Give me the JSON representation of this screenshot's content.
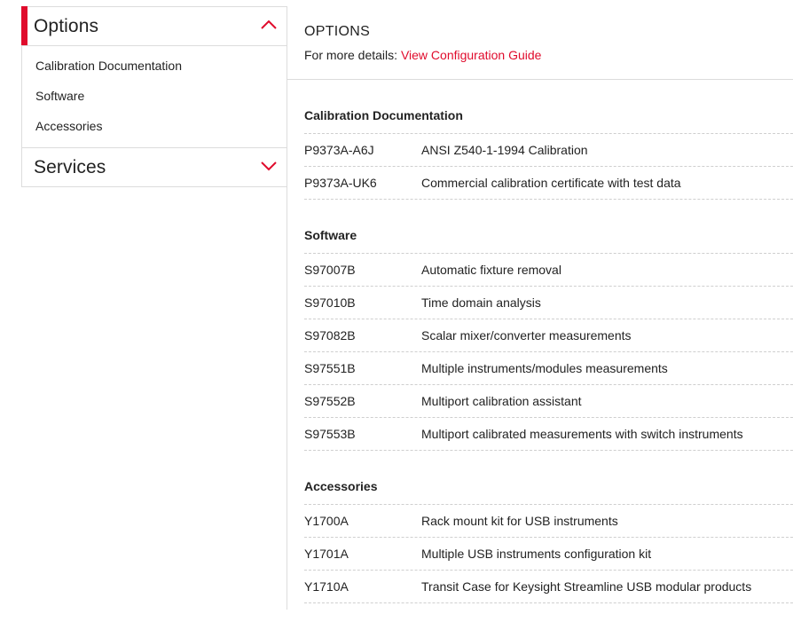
{
  "sidebar": {
    "options": {
      "title": "Options",
      "items": [
        {
          "label": "Calibration Documentation"
        },
        {
          "label": "Software"
        },
        {
          "label": "Accessories"
        }
      ]
    },
    "services": {
      "title": "Services"
    }
  },
  "main": {
    "title": "OPTIONS",
    "details_prefix": "For more details:",
    "details_link": "View Configuration Guide",
    "sections": [
      {
        "title": "Calibration Documentation",
        "rows": [
          {
            "code": "P9373A-A6J",
            "desc": "ANSI Z540-1-1994 Calibration"
          },
          {
            "code": "P9373A-UK6",
            "desc": "Commercial calibration certificate with test data"
          }
        ]
      },
      {
        "title": "Software",
        "rows": [
          {
            "code": "S97007B",
            "desc": "Automatic fixture removal"
          },
          {
            "code": "S97010B",
            "desc": "Time domain analysis"
          },
          {
            "code": "S97082B",
            "desc": "Scalar mixer/converter measurements"
          },
          {
            "code": "S97551B",
            "desc": "Multiple instruments/modules measurements"
          },
          {
            "code": "S97552B",
            "desc": "Multiport calibration assistant"
          },
          {
            "code": "S97553B",
            "desc": "Multiport calibrated measurements with switch instruments"
          }
        ]
      },
      {
        "title": "Accessories",
        "rows": [
          {
            "code": "Y1700A",
            "desc": "Rack mount kit for USB instruments"
          },
          {
            "code": "Y1701A",
            "desc": "Multiple USB instruments configuration kit"
          },
          {
            "code": "Y1710A",
            "desc": "Transit Case for Keysight Streamline USB modular products"
          }
        ]
      }
    ]
  },
  "colors": {
    "accent": "#e00b2c",
    "border": "#dcdcdc",
    "text": "#222222"
  },
  "icons": {
    "options_toggle": "chevron-up-icon",
    "services_toggle": "chevron-down-icon"
  }
}
